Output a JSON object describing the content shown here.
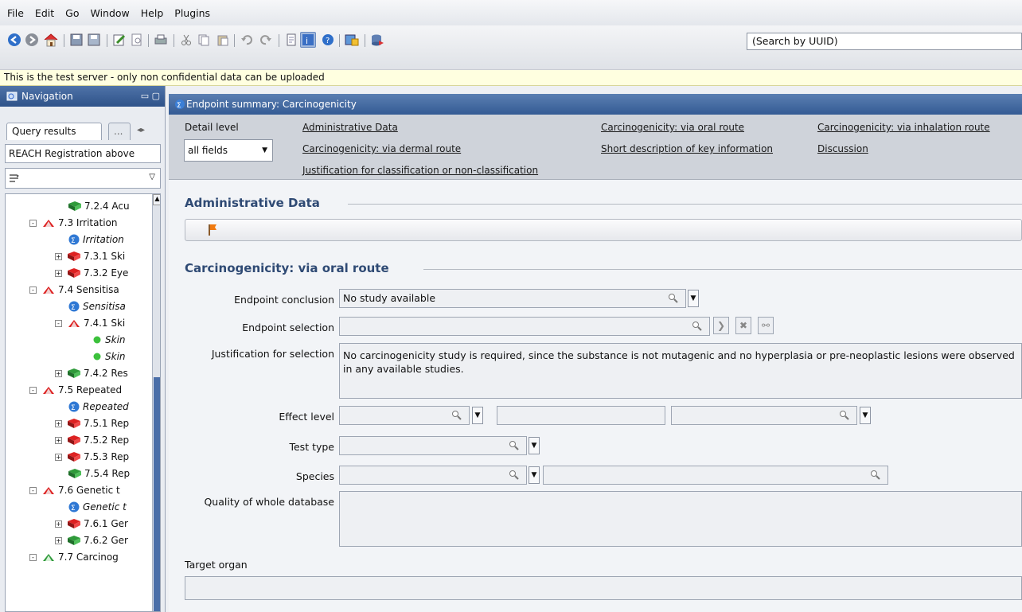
{
  "menu": [
    "File",
    "Edit",
    "Go",
    "Window",
    "Help",
    "Plugins"
  ],
  "search": {
    "value": "(Search by UUID)"
  },
  "notice": "This is the test server - only non confidential data can be uploaded",
  "nav": {
    "title": "Navigation",
    "tab_query": "Query results",
    "tab_more": "...",
    "filter": "REACH Registration above",
    "tree": [
      {
        "label": "7.2.4 Acu",
        "indent": 78,
        "icon": "book-green"
      },
      {
        "label": "7.3 Irritation",
        "indent": 30,
        "icon": "book-red-open",
        "exp": "-"
      },
      {
        "label": "Irritation",
        "indent": 78,
        "icon": "sigma",
        "italic": true
      },
      {
        "label": "7.3.1 Ski",
        "indent": 62,
        "icon": "book-red",
        "exp": "+"
      },
      {
        "label": "7.3.2 Eye",
        "indent": 62,
        "icon": "book-red",
        "exp": "+"
      },
      {
        "label": "7.4 Sensitisa",
        "indent": 30,
        "icon": "book-red-open",
        "exp": "-"
      },
      {
        "label": "Sensitisa",
        "indent": 78,
        "icon": "sigma",
        "italic": true
      },
      {
        "label": "7.4.1 Ski",
        "indent": 62,
        "icon": "book-red-open",
        "exp": "-"
      },
      {
        "label": "Skin",
        "indent": 108,
        "icon": "dot",
        "italic": true
      },
      {
        "label": "Skin",
        "indent": 108,
        "icon": "dot",
        "italic": true
      },
      {
        "label": "7.4.2 Res",
        "indent": 62,
        "icon": "book-green",
        "exp": "+"
      },
      {
        "label": "7.5 Repeated",
        "indent": 30,
        "icon": "book-red-open",
        "exp": "-"
      },
      {
        "label": "Repeated",
        "indent": 78,
        "icon": "sigma",
        "italic": true
      },
      {
        "label": "7.5.1 Rep",
        "indent": 62,
        "icon": "book-red",
        "exp": "+"
      },
      {
        "label": "7.5.2 Rep",
        "indent": 62,
        "icon": "book-red",
        "exp": "+"
      },
      {
        "label": "7.5.3 Rep",
        "indent": 62,
        "icon": "book-red",
        "exp": "+"
      },
      {
        "label": "7.5.4 Rep",
        "indent": 78,
        "icon": "book-green"
      },
      {
        "label": "7.6 Genetic t",
        "indent": 30,
        "icon": "book-red-open",
        "exp": "-"
      },
      {
        "label": "Genetic t",
        "indent": 78,
        "icon": "sigma",
        "italic": true
      },
      {
        "label": "7.6.1 Ger",
        "indent": 62,
        "icon": "book-red",
        "exp": "+"
      },
      {
        "label": "7.6.2 Ger",
        "indent": 62,
        "icon": "book-green",
        "exp": "+"
      },
      {
        "label": "7.7 Carcinog",
        "indent": 30,
        "icon": "book-green-open",
        "exp": "-"
      }
    ]
  },
  "main": {
    "title": "Endpoint summary: Carcinogenicity",
    "detail_label": "Detail level",
    "detail_value": "all fields",
    "links": {
      "l1": "Administrative Data",
      "l2": "Carcinogenicity: via dermal route",
      "l3": "Justification for classification or non-classification",
      "l4": "Carcinogenicity: via oral route",
      "l5": "Short description of key information",
      "l6": "Carcinogenicity: via inhalation route",
      "l7": "Discussion"
    },
    "sec_admin": "Administrative Data",
    "sec_oral": "Carcinogenicity: via oral route",
    "labels": {
      "conclusion": "Endpoint conclusion",
      "selection": "Endpoint selection",
      "justification": "Justification for selection",
      "effect": "Effect level",
      "test": "Test type",
      "species": "Species",
      "quality": "Quality of whole database",
      "target": "Target organ"
    },
    "values": {
      "conclusion": "No study available",
      "justification": "No carcinogenicity study is required, since the substance is not mutagenic and no hyperplasia or pre-neoplastic lesions were observed in any available studies."
    }
  }
}
